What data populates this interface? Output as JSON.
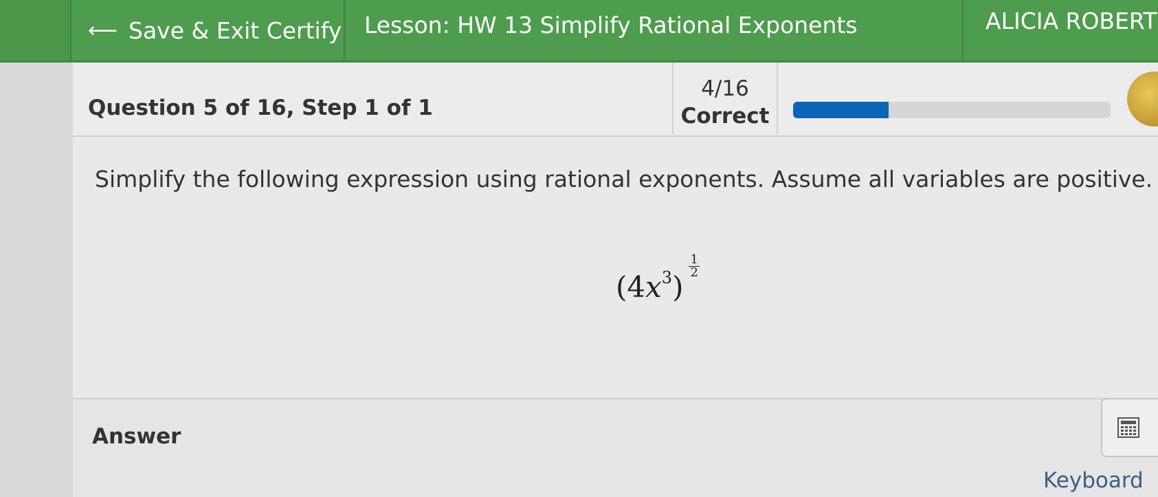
{
  "topbar": {
    "exit_label": "Save & Exit Certify",
    "lesson_title": "Lesson: HW 13 Simplify Rational Exponents",
    "user_name": "ALICIA ROBERT",
    "brand_color": "#4e9c4e"
  },
  "question": {
    "title": "Question 5 of 16, Step 1 of 1",
    "score_fraction": "4/16",
    "score_label": "Correct",
    "progress_fraction": 0.3,
    "progress_color": "#0a66b4",
    "prompt": "Simplify the following expression using rational exponents. Assume all variables are positive.",
    "expression": {
      "base_open": "(4",
      "variable": "x",
      "inner_exponent": "3",
      "base_close": ")",
      "outer_exponent_numerator": "1",
      "outer_exponent_denominator": "2"
    }
  },
  "answer": {
    "label": "Answer",
    "keyboard_label": "Keyboard",
    "keyboard_icon": "calculator-icon"
  }
}
